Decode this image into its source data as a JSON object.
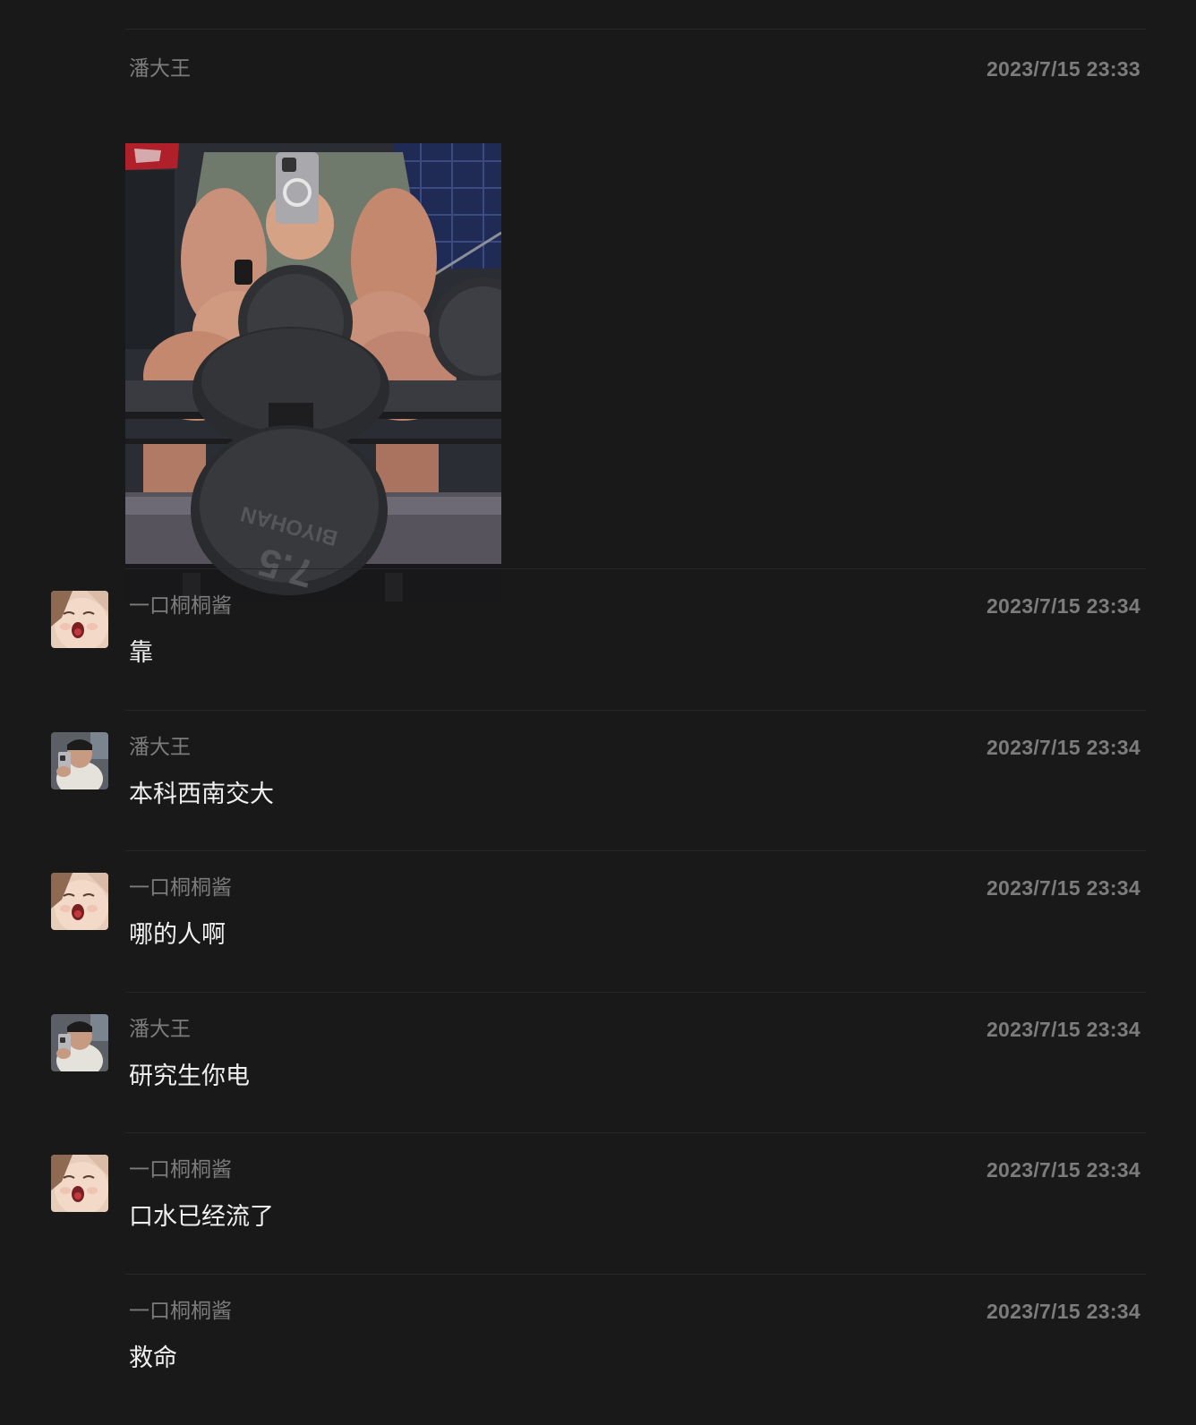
{
  "messages": [
    {
      "sender": "潘大王",
      "time": "2023/7/15 23:33",
      "type": "image",
      "show_avatar": false,
      "image_label": "gym-mirror-selfie-photo"
    },
    {
      "sender": "一口桐桐酱",
      "time": "2023/7/15 23:34",
      "type": "text",
      "text": "靠",
      "show_avatar": true,
      "avatar": "baby-face-avatar"
    },
    {
      "sender": "潘大王",
      "time": "2023/7/15 23:34",
      "type": "text",
      "text": "本科西南交大",
      "show_avatar": true,
      "avatar": "gym-selfie-avatar"
    },
    {
      "sender": "一口桐桐酱",
      "time": "2023/7/15 23:34",
      "type": "text",
      "text": "哪的人啊",
      "show_avatar": true,
      "avatar": "baby-face-avatar"
    },
    {
      "sender": "潘大王",
      "time": "2023/7/15 23:34",
      "type": "text",
      "text": "研究生你电",
      "show_avatar": true,
      "avatar": "gym-selfie-avatar"
    },
    {
      "sender": "一口桐桐酱",
      "time": "2023/7/15 23:34",
      "type": "text",
      "text": "口水已经流了",
      "show_avatar": true,
      "avatar": "baby-face-avatar"
    },
    {
      "sender": "一口桐桐酱",
      "time": "2023/7/15 23:34",
      "type": "text",
      "text": "救命",
      "show_avatar": false,
      "avatar": "baby-face-avatar"
    }
  ],
  "image_texts": {
    "dumbbell_brand": "BIYOHAN",
    "dumbbell_weight": "7.5"
  },
  "colors": {
    "background": "#191919",
    "divider": "#262626",
    "meta_text": "#7c7c7c",
    "message_text": "#f0f0f0"
  }
}
